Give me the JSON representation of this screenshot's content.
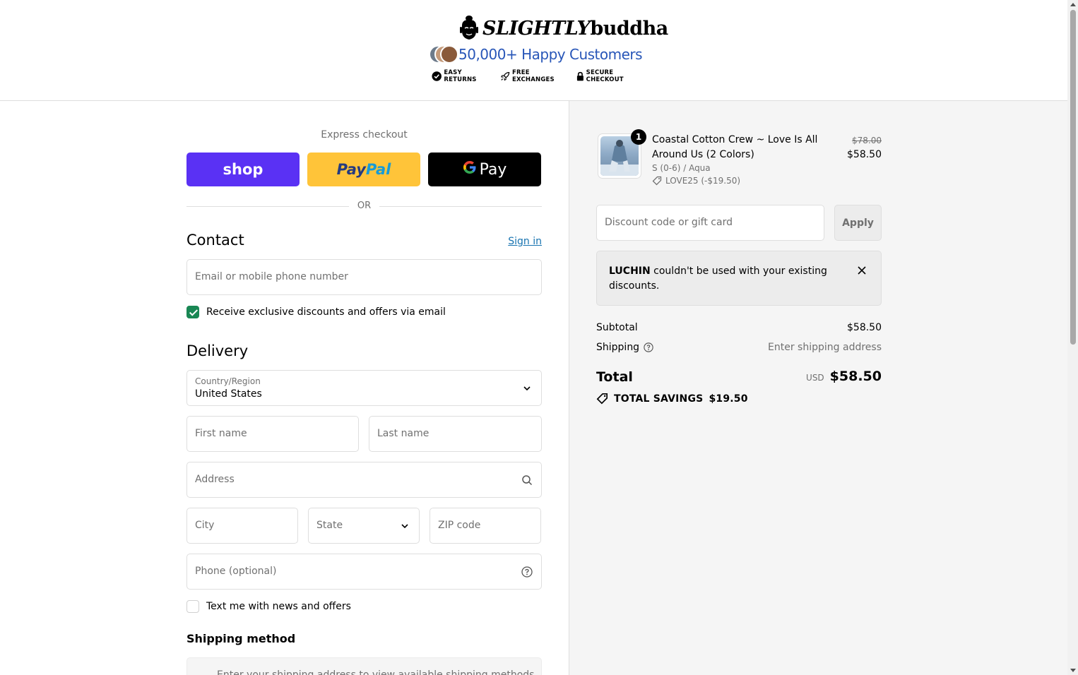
{
  "brand": {
    "logo_text_script": "SLIGHTLY",
    "logo_text_bold": "buddha",
    "happy_customers": "50,000+ Happy Customers",
    "trust": [
      {
        "icon": "check-circle-icon",
        "label": "EASY RETURNS"
      },
      {
        "icon": "rocket-icon",
        "label": "FREE EXCHANGES"
      },
      {
        "icon": "lock-icon",
        "label": "SECURE CHECKOUT"
      }
    ]
  },
  "express": {
    "label": "Express checkout",
    "shop": "shop",
    "paypal_1": "Pay",
    "paypal_2": "Pal",
    "gpay_g": "G",
    "gpay": "Pay",
    "or": "OR"
  },
  "contact": {
    "title": "Contact",
    "sign_in": "Sign in",
    "email_placeholder": "Email or mobile phone number",
    "email_offers": "Receive exclusive discounts and offers via email",
    "email_offers_checked": true
  },
  "delivery": {
    "title": "Delivery",
    "country_label": "Country/Region",
    "country_value": "United States",
    "first_name": "First name",
    "last_name": "Last name",
    "address": "Address",
    "city": "City",
    "state": "State",
    "zip": "ZIP code",
    "phone": "Phone (optional)",
    "text_offers": "Text me with news and offers",
    "text_offers_checked": false
  },
  "shipping": {
    "title": "Shipping method",
    "message": "Enter your shipping address to view available shipping methods."
  },
  "order": {
    "product": {
      "name": "Coastal Cotton Crew ~ Love Is All Around Us (2 Colors)",
      "variant": "S (0-6) / Aqua",
      "discount": "LOVE25 (-$19.50)",
      "quantity": "1",
      "price_old": "$78.00",
      "price_new": "$58.50"
    },
    "discount_placeholder": "Discount code or gift card",
    "apply": "Apply",
    "notice_code": "LUCHIN",
    "notice_text": " couldn't be used with your existing discounts.",
    "subtotal_label": "Subtotal",
    "subtotal_value": "$58.50",
    "shipping_label": "Shipping",
    "shipping_value": "Enter shipping address",
    "total_label": "Total",
    "currency": "USD",
    "total_value": "$58.50",
    "savings_label": "TOTAL SAVINGS",
    "savings_value": "$19.50"
  },
  "colors": {
    "shop_purple": "#5a31f4",
    "paypal_yellow": "#ffc439",
    "link_blue": "#1773b0",
    "check_green": "#198754"
  }
}
